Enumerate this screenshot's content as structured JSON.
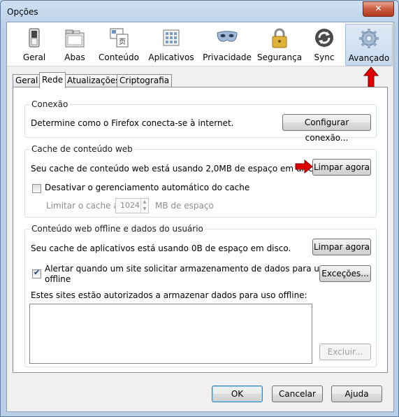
{
  "window": {
    "title": "Opções",
    "close_glyph": "✕"
  },
  "toolbar": {
    "items": [
      {
        "label": "Geral",
        "icon": "switch-icon"
      },
      {
        "label": "Abas",
        "icon": "tabs-folder-icon"
      },
      {
        "label": "Conteúdo",
        "icon": "content-document-icon"
      },
      {
        "label": "Aplicativos",
        "icon": "applications-icon"
      },
      {
        "label": "Privacidade",
        "icon": "mask-icon"
      },
      {
        "label": "Segurança",
        "icon": "padlock-icon"
      },
      {
        "label": "Sync",
        "icon": "sync-icon"
      },
      {
        "label": "Avançado",
        "icon": "gear-icon",
        "selected": true
      }
    ]
  },
  "subtabs": [
    {
      "label": "Geral"
    },
    {
      "label": "Rede",
      "selected": true
    },
    {
      "label": "Atualizações"
    },
    {
      "label": "Criptografia"
    }
  ],
  "conexao": {
    "title": "Conexão",
    "text": "Determine como o Firefox conecta-se à internet.",
    "button": "Configurar conexão..."
  },
  "cache": {
    "title": "Cache de conteúdo web",
    "text": "Seu cache de conteúdo web está usando 2,0MB de espaço em disco.",
    "button": "Limpar agora",
    "override_label": "Desativar o gerenciamento automático do cache",
    "limit_label": "Limitar o cache a",
    "limit_value": "1024",
    "limit_unit": "MB de espaço"
  },
  "offline": {
    "title": "Conteúdo web offline e dados do usuário",
    "text": "Seu cache de aplicativos está usando 0B de espaço em disco.",
    "clear_button": "Limpar agora",
    "warn_label_1": "Alertar quando um site solicitar armazenamento de dados para uso",
    "warn_label_2": "offline",
    "exceptions_button": "Exceções...",
    "sites_label": "Estes sites estão autorizados a armazenar dados para uso offline:",
    "remove_button": "Excluir..."
  },
  "footer": {
    "ok": "OK",
    "cancel": "Cancelar",
    "help": "Ajuda"
  },
  "colors": {
    "annotation_arrow": "#e00000",
    "selected_tab": "#c8daf0"
  }
}
